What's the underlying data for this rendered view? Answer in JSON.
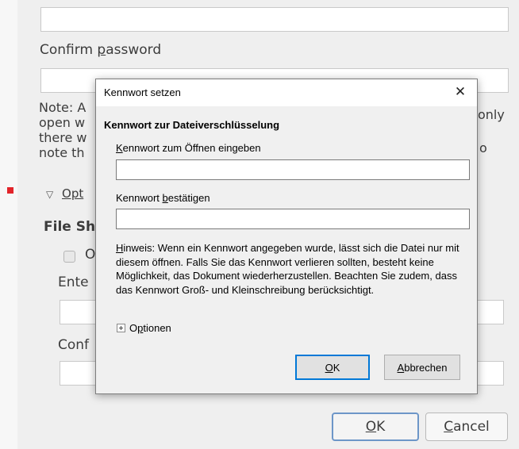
{
  "background_dialog": {
    "confirm_password_label_prefix": "Confirm ",
    "confirm_password_label_mnemonic": "p",
    "confirm_password_label_rest": "assword",
    "note_lines_left": [
      "Note: A",
      "open w",
      "there w",
      "note th"
    ],
    "note_lines_right": [
      "only",
      "o"
    ],
    "options_expander_label": "Opt",
    "file_sharing_heading": "File Sh",
    "checkbox_label": "O",
    "enter_label": "Ente",
    "confirm_label": "Conf",
    "ok_mnemonic": "O",
    "ok_rest": "K",
    "cancel_mnemonic": "C",
    "cancel_rest": "ancel"
  },
  "dialog": {
    "title": "Kennwort setzen",
    "close_icon": "close-icon",
    "section_heading": "Kennwort zur Dateiverschlüsselung",
    "open_password_mnemonic": "K",
    "open_password_rest": "ennwort zum Öffnen eingeben",
    "confirm_password_prefix": "Kennwort ",
    "confirm_password_mnemonic": "b",
    "confirm_password_rest": "estätigen",
    "open_password_value": "",
    "confirm_password_value": "",
    "hint_mnemonic": "H",
    "hint_rest": "inweis: Wenn ein Kennwort angegeben wurde, lässt sich die Datei nur mit diesem öffnen. Falls Sie das Kennwort verlieren sollten, besteht keine Möglichkeit, das Dokument wiederherzustellen. Beachten Sie zudem, dass das Kennwort Groß- und Kleinschreibung berücksichtigt.",
    "options_prefix": "O",
    "options_mnemonic": "p",
    "options_rest": "tionen",
    "ok_mnemonic": "O",
    "ok_rest": "K",
    "cancel_mnemonic": "A",
    "cancel_rest": "bbrechen"
  },
  "colors": {
    "default_button_border": "#0078d7",
    "marker": "#e2242a"
  }
}
